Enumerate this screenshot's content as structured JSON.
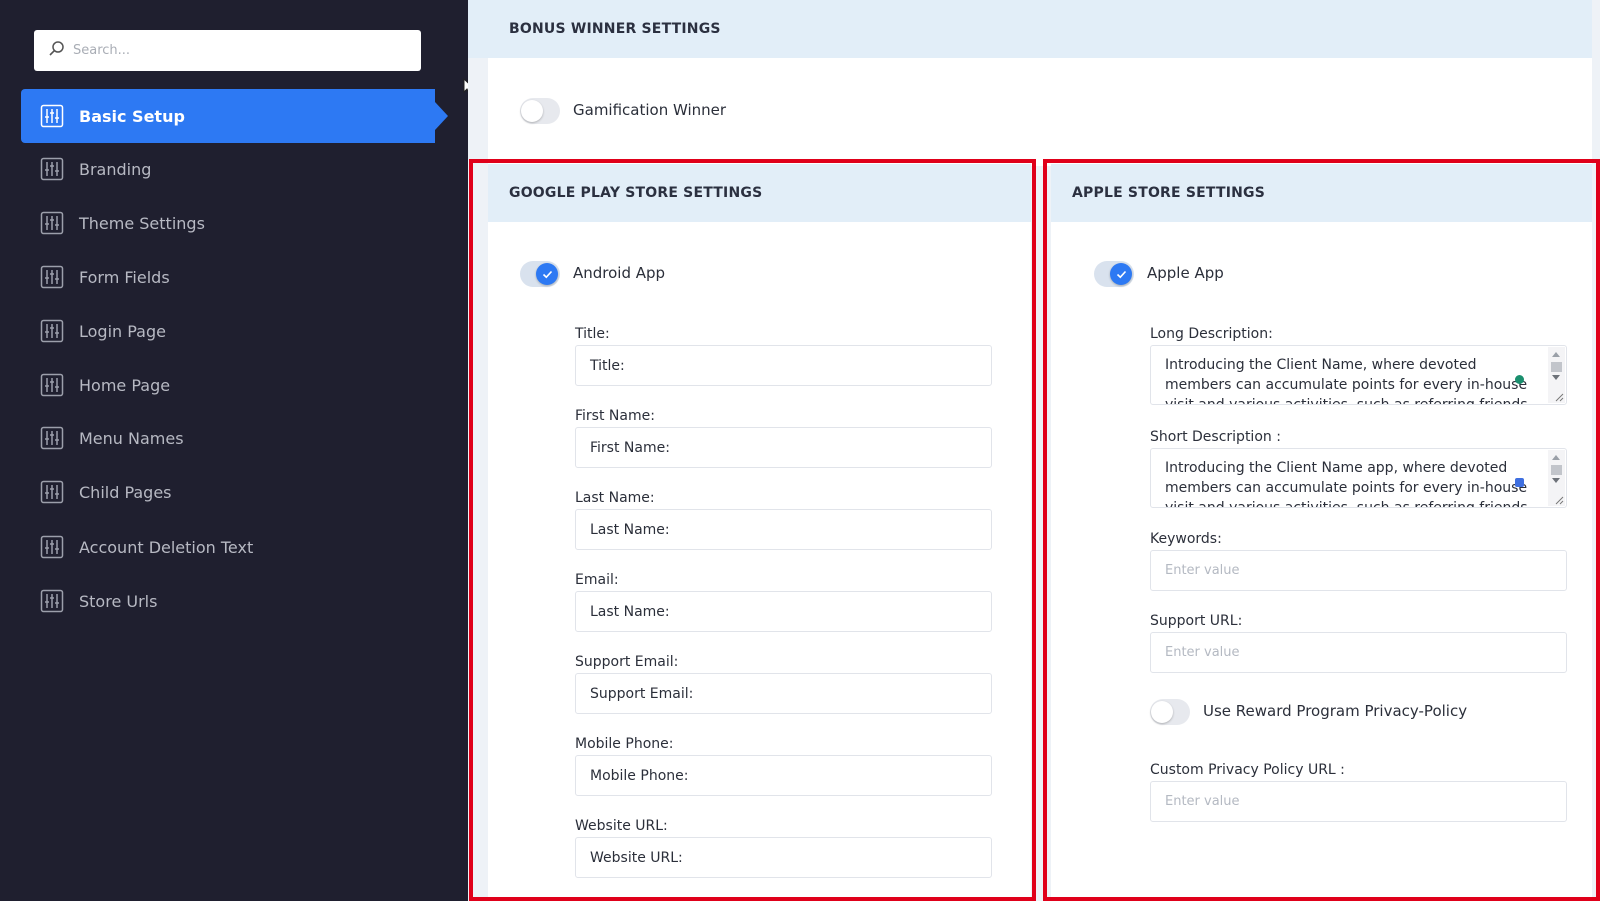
{
  "search": {
    "placeholder": "Search..."
  },
  "sidebar": {
    "items": [
      {
        "label": "Basic Setup",
        "active": true
      },
      {
        "label": "Branding"
      },
      {
        "label": "Theme Settings"
      },
      {
        "label": "Form Fields"
      },
      {
        "label": "Login Page"
      },
      {
        "label": "Home Page"
      },
      {
        "label": "Menu Names"
      },
      {
        "label": "Child Pages"
      },
      {
        "label": "Account Deletion Text"
      },
      {
        "label": "Store Urls"
      }
    ]
  },
  "bonus": {
    "header": "BONUS WINNER SETTINGS",
    "toggle_label": "Gamification Winner",
    "toggle_on": false
  },
  "google": {
    "header": "GOOGLE PLAY STORE SETTINGS",
    "toggle_label": "Android App",
    "toggle_on": true,
    "fields": [
      {
        "label": "Title:",
        "value": "Title:"
      },
      {
        "label": "First Name:",
        "value": "First Name:"
      },
      {
        "label": "Last Name:",
        "value": "Last Name:"
      },
      {
        "label": "Email:",
        "value": "Last Name:"
      },
      {
        "label": "Support Email:",
        "value": "Support Email:"
      },
      {
        "label": "Mobile Phone:",
        "value": "Mobile Phone:"
      },
      {
        "label": "Website URL:",
        "value": "Website URL:"
      }
    ]
  },
  "apple": {
    "header": "APPLE STORE SETTINGS",
    "toggle_label": "Apple App",
    "toggle_on": true,
    "long_description": {
      "label": "Long Description:",
      "value": "Introducing the Client Name, where devoted members can accumulate points for every in-house visit and various activities, such as referring friends"
    },
    "short_description": {
      "label": "Short Description :",
      "value": "Introducing the Client Name app, where devoted members can accumulate points for every in-house visit and various activities, such as referring friends"
    },
    "keywords": {
      "label": "Keywords:",
      "placeholder": "Enter value"
    },
    "support_url": {
      "label": "Support URL:",
      "placeholder": "Enter value"
    },
    "privacy_toggle": {
      "label": "Use Reward Program Privacy-Policy",
      "on": false
    },
    "custom_privacy": {
      "label": "Custom Privacy Policy URL :",
      "placeholder": "Enter value"
    }
  },
  "colors": {
    "sidebar_bg": "#1f1f2f",
    "accent": "#2d79f3",
    "highlight_frame": "#e0001a"
  }
}
